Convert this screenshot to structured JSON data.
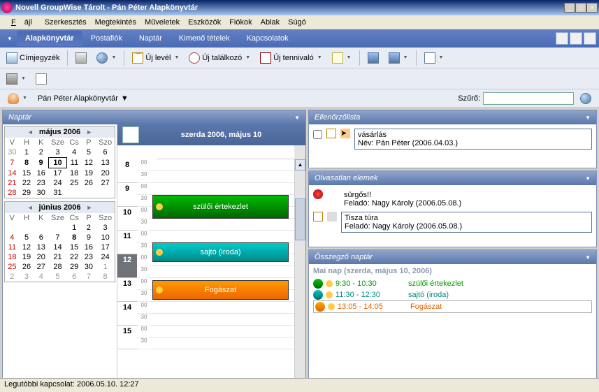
{
  "window": {
    "title": "Novell GroupWise Tárolt - Pán Péter Alapkönyvtár"
  },
  "menu": [
    "Fájl",
    "Szerkesztés",
    "Megtekintés",
    "Műveletek",
    "Eszközök",
    "Fiókok",
    "Ablak",
    "Súgó"
  ],
  "navtabs": {
    "items": [
      "Alapkönyvtár",
      "Postafiók",
      "Naptár",
      "Kimenő tételek",
      "Kapcsolatok"
    ],
    "active": 0
  },
  "toolbar": {
    "addressbook": "Címjegyzék",
    "newmail": "Új levél",
    "newmeeting": "Új találkozó",
    "newtask": "Új tennivaló"
  },
  "location": {
    "path": "Pán Péter Alapkönyvtár",
    "filter_label": "Szűrő:",
    "filter_value": ""
  },
  "calendar_panel": {
    "title": "Naptár",
    "day_header": "szerda 2006, május 10",
    "month1": {
      "title": "május 2006",
      "dow": [
        "V",
        "H",
        "K",
        "Sze",
        "Cs",
        "P",
        "Szo"
      ],
      "prev_tail": [
        30
      ],
      "days": [
        1,
        2,
        3,
        4,
        5,
        6,
        7,
        8,
        9,
        10,
        11,
        12,
        13,
        14,
        15,
        16,
        17,
        18,
        19,
        20,
        21,
        22,
        23,
        24,
        25,
        26,
        27,
        28,
        29,
        30,
        31
      ],
      "today": 10,
      "bold_days": [
        8,
        9,
        10
      ]
    },
    "month2": {
      "title": "június 2006",
      "dow": [
        "V",
        "H",
        "K",
        "Sze",
        "Cs",
        "P",
        "Szo"
      ],
      "days": [
        1,
        2,
        3,
        4,
        5,
        6,
        7,
        8,
        9,
        10,
        11,
        12,
        13,
        14,
        15,
        16,
        17,
        18,
        19,
        20,
        21,
        22,
        23,
        24,
        25,
        26,
        27,
        28,
        29,
        30
      ],
      "next_tail": [
        1,
        2,
        3,
        4,
        5,
        6,
        7,
        8
      ],
      "bold_days": [
        8
      ]
    },
    "hours": [
      8,
      9,
      10,
      11,
      12,
      13,
      14,
      15
    ],
    "selected_hour": 12,
    "appointments": {
      "a1": "szülői értekezlet",
      "a2": "sajtó (iroda)",
      "a3": "Fogászat"
    }
  },
  "checklist": {
    "title": "Ellenőrzőlista",
    "items": [
      {
        "title": "vásárlás",
        "sub": "Név: Pán Péter (2006.04.03.)"
      }
    ]
  },
  "unread": {
    "title": "Olvasatlan elemek",
    "items": [
      {
        "title": "sürgős!!",
        "sub": "Feladó: Nagy Károly (2006.05.08.)"
      },
      {
        "title": "Tisza túra",
        "sub": "Feladó: Nagy Károly (2006.05.08.)"
      }
    ]
  },
  "summary": {
    "title": "Összegző naptár",
    "head": "Mai nap (szerda, május 10, 2006)",
    "rows": [
      {
        "time": "9:30 - 10:30",
        "label": "szülői értekezlet"
      },
      {
        "time": "11:30 - 12:30",
        "label": "sajtó (iroda)"
      },
      {
        "time": "13:05 - 14:05",
        "label": "Fogászat"
      }
    ]
  },
  "status": "Legutóbbi kapcsolat: 2006.05.10. 12:27"
}
